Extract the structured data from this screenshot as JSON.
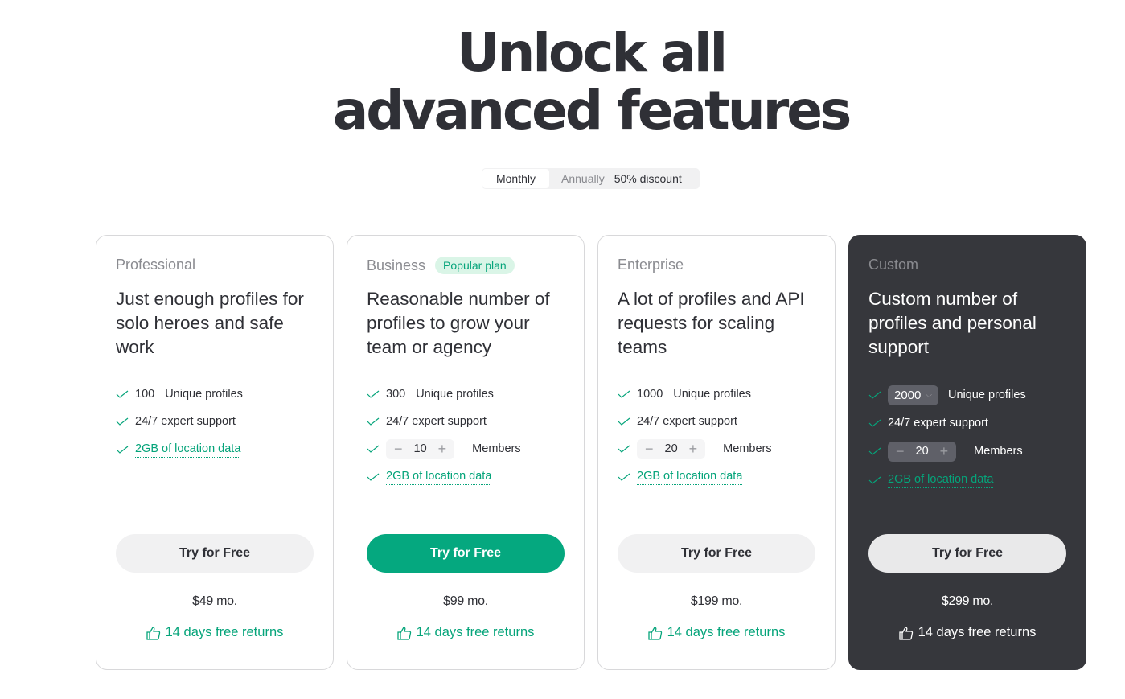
{
  "header": {
    "title_line1": "Unlock all",
    "title_line2": "advanced features"
  },
  "billing_toggle": {
    "monthly": "Monthly",
    "annually": "Annually",
    "discount": "50% discount",
    "selected": "Monthly"
  },
  "colors": {
    "accent": "#05a87f",
    "dark_card": "#36373c",
    "text": "#2f3036"
  },
  "plans": [
    {
      "name": "Professional",
      "description": "Just enough profiles for solo heroes and safe work",
      "profiles": "100",
      "profiles_label": "Unique profiles",
      "support": "24/7 expert support",
      "location": "2GB of location data",
      "button": "Try for Free",
      "price": "$49 mo.",
      "returns": "14 days free returns"
    },
    {
      "name": "Business",
      "badge": "Popular plan",
      "description": "Reasonable number of profiles to grow your team or agency",
      "profiles": "300",
      "profiles_label": "Unique profiles",
      "support": "24/7 expert support",
      "members": "10",
      "members_label": "Members",
      "location": "2GB of location data",
      "button": "Try for Free",
      "price": "$99 mo.",
      "returns": "14 days free returns"
    },
    {
      "name": "Enterprise",
      "description": "A lot of profiles and API requests for scaling teams",
      "profiles": "1000",
      "profiles_label": "Unique profiles",
      "support": "24/7 expert support",
      "members": "20",
      "members_label": "Members",
      "location": "2GB of location data",
      "button": "Try for Free",
      "price": "$199 mo.",
      "returns": "14 days free returns"
    },
    {
      "name": "Custom",
      "description": "Custom number of profiles and personal support",
      "profiles": "2000",
      "profiles_label": "Unique profiles",
      "support": "24/7 expert support",
      "members": "20",
      "members_label": "Members",
      "location": "2GB of location data",
      "button": "Try for Free",
      "price": "$299 mo.",
      "returns": "14 days free returns"
    }
  ]
}
